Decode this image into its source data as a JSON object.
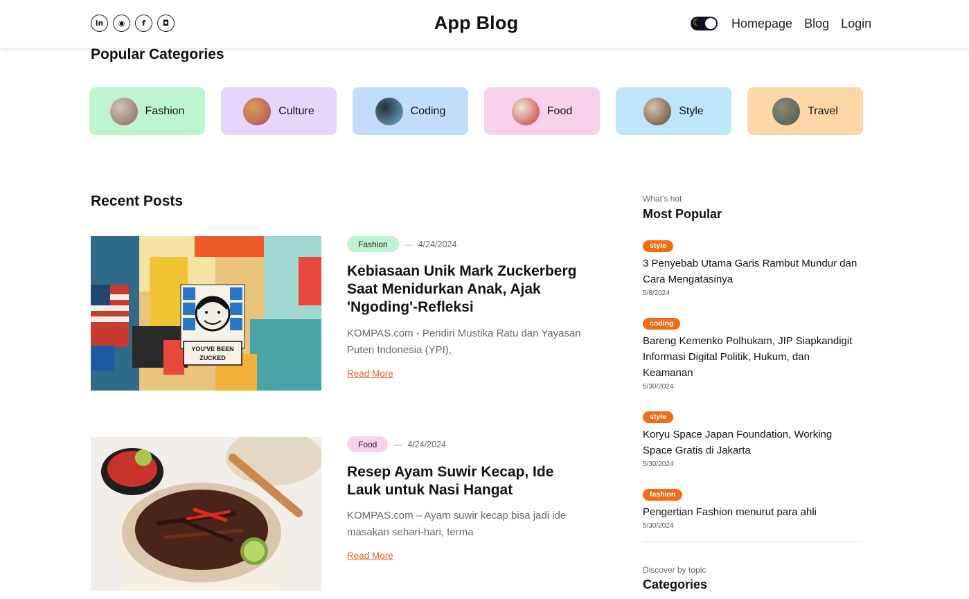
{
  "header": {
    "brand": "App Blog",
    "socials": [
      {
        "name": "linkedin-icon",
        "glyph": "in"
      },
      {
        "name": "github-icon",
        "glyph": "◉"
      },
      {
        "name": "facebook-icon",
        "glyph": "f"
      },
      {
        "name": "instagram-icon",
        "glyph": "◘"
      }
    ],
    "theme_toggle_icon": "moon-icon",
    "nav": {
      "homepage": "Homepage",
      "blog": "Blog",
      "login": "Login"
    }
  },
  "popular": {
    "title": "Popular Categories",
    "categories": [
      {
        "label": "Fashion",
        "bg": "#bdf5d0",
        "thumb": [
          "#cfc4b8",
          "#8a6a55"
        ]
      },
      {
        "label": "Culture",
        "bg": "#e6d6fb",
        "thumb": [
          "#d9a050",
          "#b04a6a"
        ]
      },
      {
        "label": "Coding",
        "bg": "#c3dcfc",
        "thumb": [
          "#2a2d33",
          "#6fb0d8"
        ]
      },
      {
        "label": "Food",
        "bg": "#fad1ea",
        "thumb": [
          "#efe6d8",
          "#c8343c"
        ]
      },
      {
        "label": "Style",
        "bg": "#bde6fb",
        "thumb": [
          "#d8c2ae",
          "#5a4636"
        ]
      },
      {
        "label": "Travel",
        "bg": "#fed7a9",
        "thumb": [
          "#8c8678",
          "#4f5a4a"
        ]
      }
    ]
  },
  "recent": {
    "title": "Recent Posts",
    "posts": [
      {
        "category": "Fashion",
        "badge_bg": "#bdf5d0",
        "dash": "—",
        "date": "4/24/2024",
        "title": "Kebiasaan Unik Mark Zuckerberg Saat Menidurkan Anak, Ajak 'Ngoding'-Refleksi",
        "excerpt": "KOMPAS.com - Pendiri Mustika Ratu dan Yayasan Puteri Indonesia (YPI),",
        "more": "Read More",
        "image_text": [
          "YOU'VE BEEN",
          "ZUCKED"
        ]
      },
      {
        "category": "Food",
        "badge_bg": "#fad1ea",
        "dash": "—",
        "date": "4/24/2024",
        "title": "Resep Ayam Suwir Kecap, Ide Lauk untuk Nasi Hangat",
        "excerpt": "KOMPAS.com – Ayam suwir kecap bisa jadi ide masakan sehari-hari, terma",
        "more": "Read More"
      }
    ]
  },
  "sidebar": {
    "hot_sub": "What's hot",
    "hot_title": "Most Popular",
    "items": [
      {
        "badge": "style",
        "title": "3 Penyebab Utama Garis Rambut Mundur dan Cara Mengatasinya",
        "date": "5/8/2024"
      },
      {
        "badge": "coding",
        "title": "Bareng Kemenko Polhukam, JIP Siapkandigit Informasi Digital Politik, Hukum, dan Keamanan",
        "date": "5/30/2024"
      },
      {
        "badge": "style",
        "title": "Koryu Space Japan Foundation, Working Space Gratis di Jakarta",
        "date": "5/30/2024"
      },
      {
        "badge": "fashion",
        "title": "Pengertian Fashion menurut para ahli",
        "date": "5/30/2024"
      }
    ],
    "topic_sub": "Discover by topic",
    "topic_title": "Categories"
  },
  "colors": {
    "accent": "#f26b15",
    "link": "#e0622a"
  }
}
